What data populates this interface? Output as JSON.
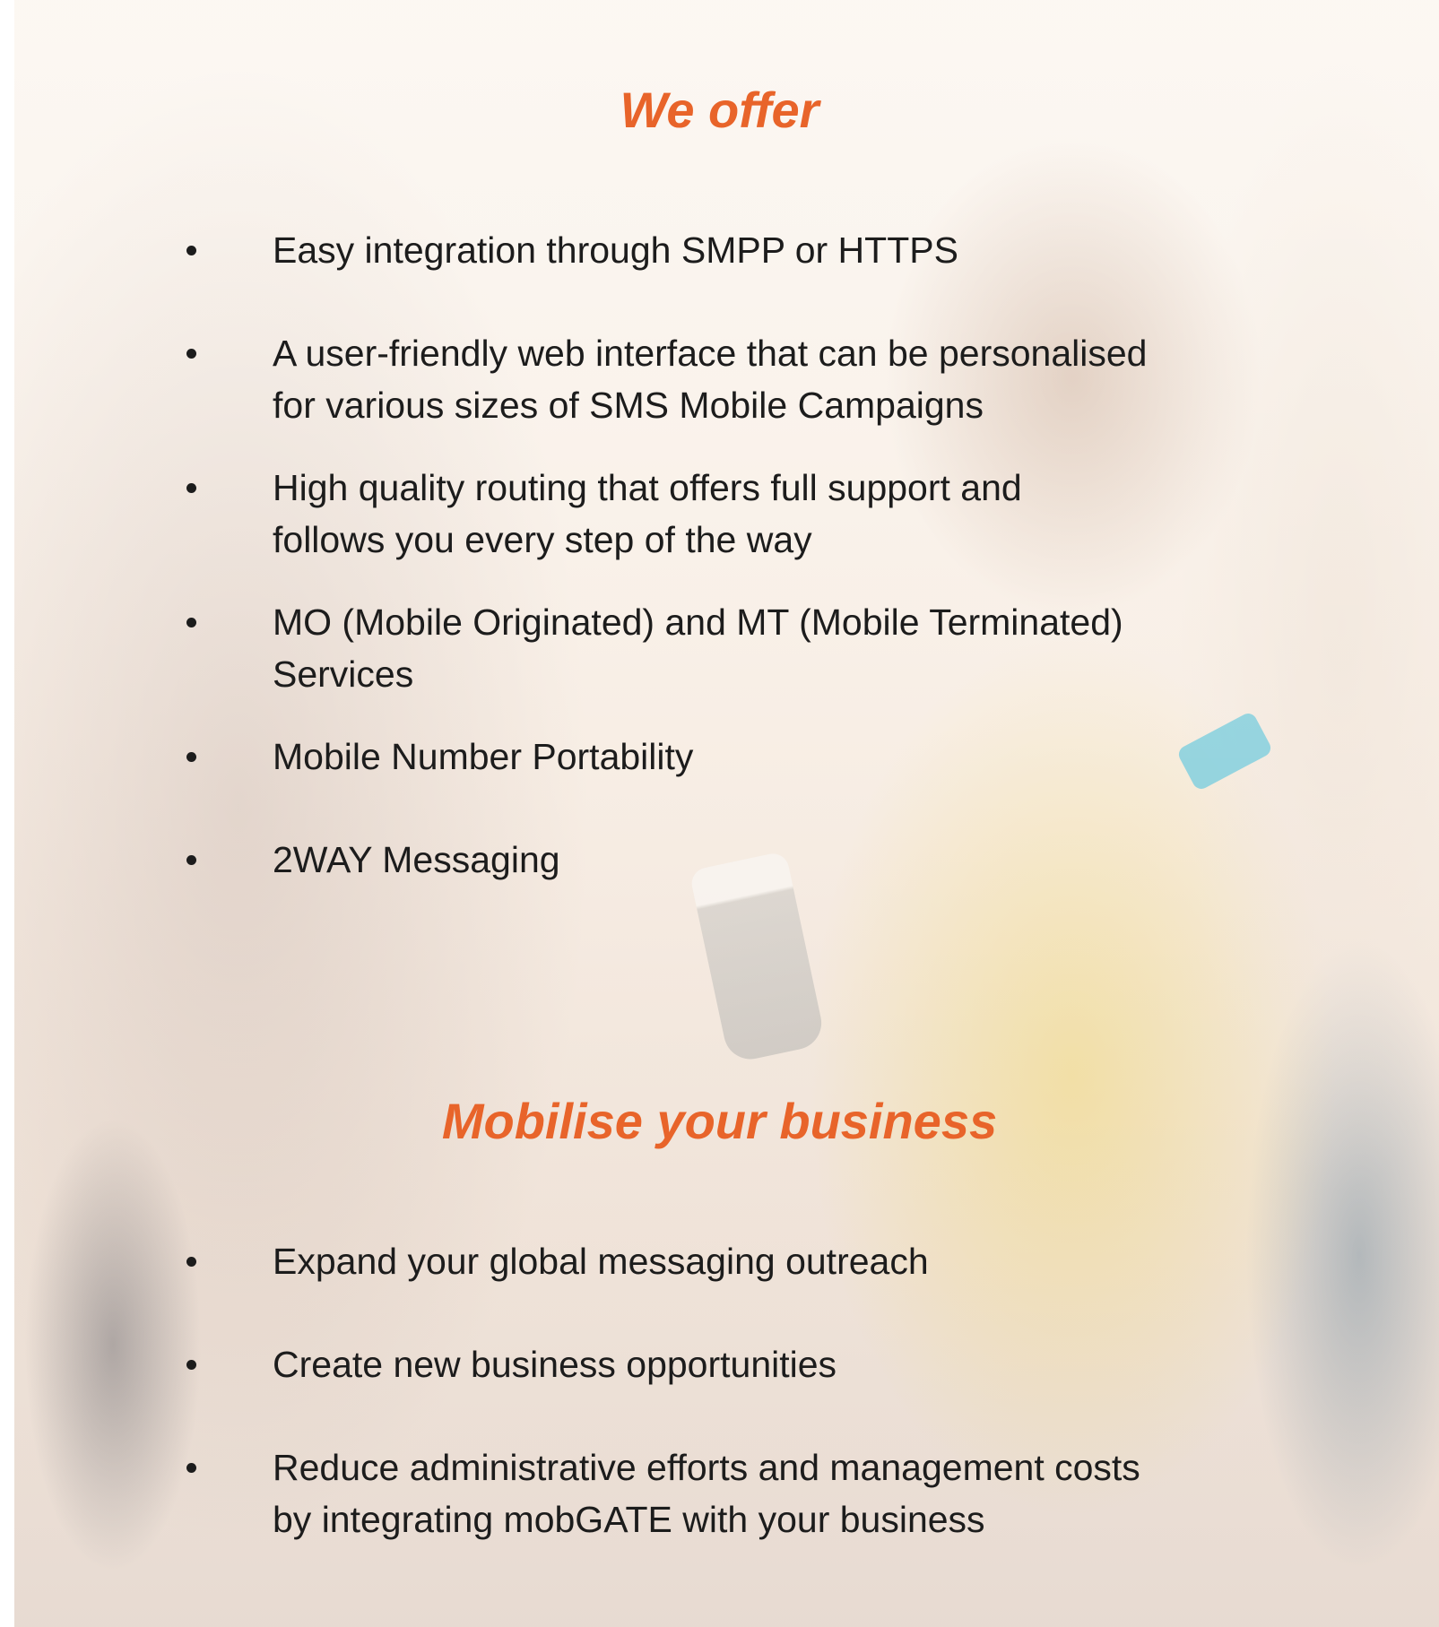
{
  "sections": {
    "offer": {
      "heading": "We offer",
      "items": [
        {
          "line1": "Easy integration through SMPP or HTTPS",
          "line2": ""
        },
        {
          "line1": "A user-friendly web interface that can be personalised",
          "line2": "for various sizes of SMS Mobile Campaigns"
        },
        {
          "line1": "High quality routing that offers full support and",
          "line2": "follows you every step of the way"
        },
        {
          "line1": "MO (Mobile Originated) and MT (Mobile Terminated)",
          "line2": "Services"
        },
        {
          "line1": "Mobile Number Portability",
          "line2": ""
        },
        {
          "line1": "2WAY Messaging",
          "line2": ""
        }
      ]
    },
    "mobilise": {
      "heading": "Mobilise your business",
      "items": [
        {
          "line1": "Expand your global messaging outreach",
          "line2": ""
        },
        {
          "line1": "Create new business opportunities",
          "line2": ""
        },
        {
          "line1": "Reduce administrative efforts and management costs",
          "line2": "by integrating mobGATE with your business"
        }
      ]
    }
  },
  "colors": {
    "heading": "#e8642a",
    "text": "#1c1c1c"
  }
}
